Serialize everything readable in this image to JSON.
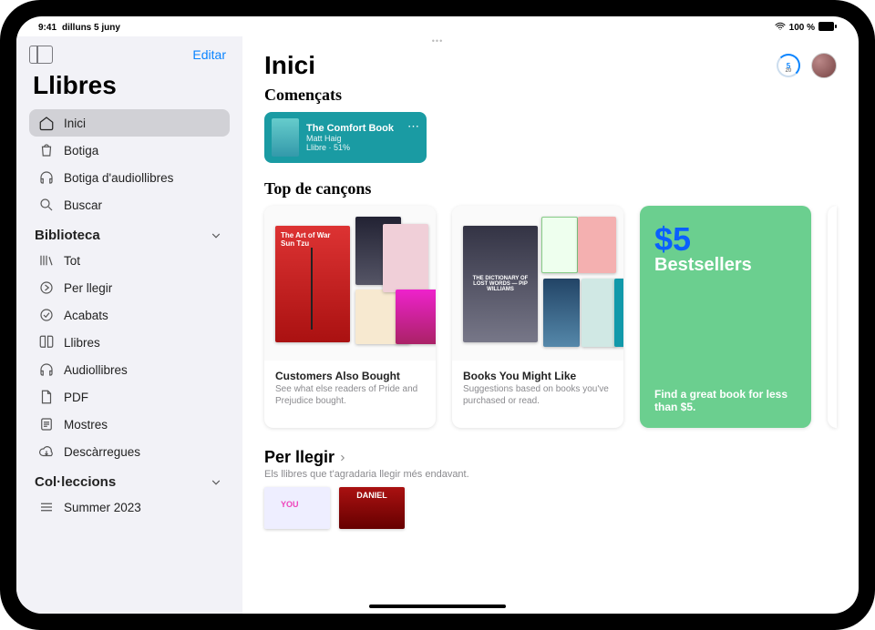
{
  "status": {
    "time": "9:41",
    "date": "dilluns 5 juny",
    "battery": "100 %"
  },
  "sidebar": {
    "edit": "Editar",
    "app": "Llibres",
    "nav": [
      {
        "id": "home",
        "label": "Inici"
      },
      {
        "id": "store",
        "label": "Botiga"
      },
      {
        "id": "audiostore",
        "label": "Botiga d'audiollibres"
      },
      {
        "id": "search",
        "label": "Buscar"
      }
    ],
    "library_head": "Biblioteca",
    "library": [
      {
        "id": "all",
        "label": "Tot"
      },
      {
        "id": "toread",
        "label": "Per llegir"
      },
      {
        "id": "finished",
        "label": "Acabats"
      },
      {
        "id": "books",
        "label": "Llibres"
      },
      {
        "id": "audio",
        "label": "Audiollibres"
      },
      {
        "id": "pdf",
        "label": "PDF"
      },
      {
        "id": "samples",
        "label": "Mostres"
      },
      {
        "id": "downloads",
        "label": "Descàrregues"
      }
    ],
    "collections_head": "Col·leccions",
    "collections": [
      {
        "id": "summer",
        "label": "Summer 2023"
      }
    ]
  },
  "main": {
    "title": "Inici",
    "goal": {
      "top": "5",
      "bottom": "20"
    },
    "started": {
      "head": "Començats",
      "card": {
        "title": "The Comfort Book",
        "author": "Matt Haig",
        "meta": "Llibre · 51%"
      }
    },
    "top": {
      "head": "Top de cançons",
      "cards": [
        {
          "cover_label": "The Art of War\nSun Tzu",
          "title": "Customers Also Bought",
          "sub": "See what else readers of Pride and Prejudice bought."
        },
        {
          "cover_label": "THE DICTIONARY OF LOST WORDS — PIP WILLIAMS",
          "title": "Books You Might Like",
          "sub": "Suggestions based on books you've purchased or read."
        }
      ],
      "promo": {
        "big": "$5",
        "mid": "Bestsellers",
        "small": "Find a great book for less than $5."
      }
    },
    "want": {
      "title": "Per llegir",
      "sub": "Els llibres que t'agradaria llegir més endavant.",
      "cover2": "DANIEL"
    }
  }
}
